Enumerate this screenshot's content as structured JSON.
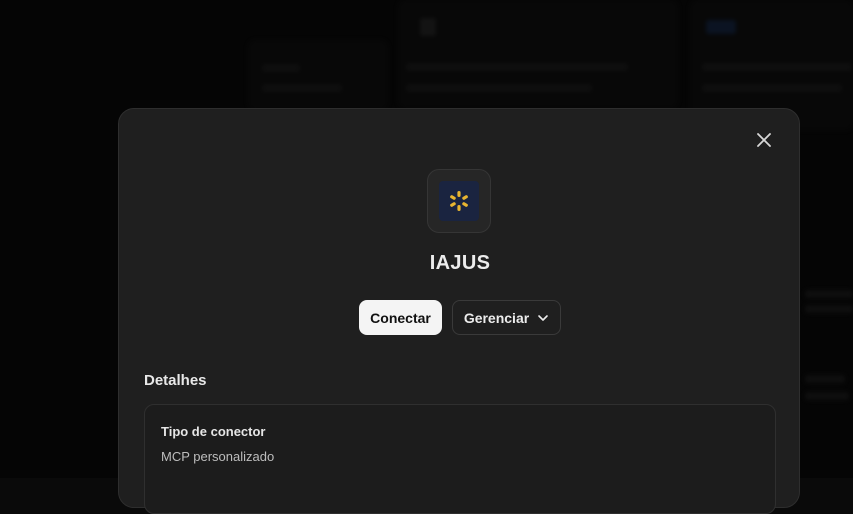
{
  "modal": {
    "title": "IAJUS",
    "connect_label": "Conectar",
    "manage_label": "Gerenciar",
    "details_heading": "Detalhes",
    "details": {
      "connector_type_label": "Tipo de conector",
      "connector_type_value": "MCP personalizado"
    }
  },
  "icons": {
    "close": "close-icon",
    "chevron": "chevron-down-icon",
    "logo": "connector-logo-icon"
  },
  "colors": {
    "logo_accent": "#e8b530",
    "logo_bg": "#1a2440",
    "primary_button": "#f4f4f4",
    "modal_bg": "#1f1f1f"
  }
}
